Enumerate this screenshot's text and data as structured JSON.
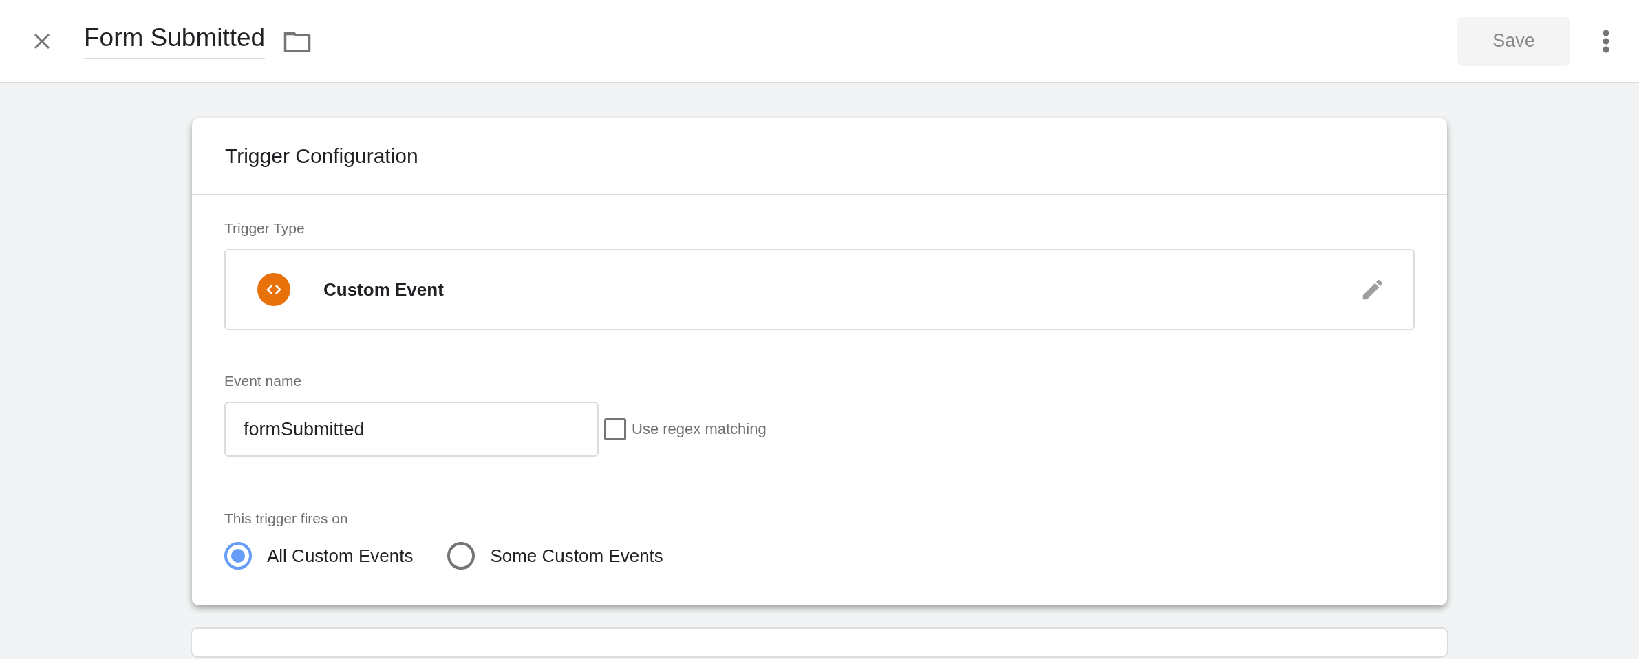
{
  "header": {
    "title": "Form Submitted",
    "save_button": {
      "label": "Save",
      "disabled": true
    }
  },
  "card": {
    "title": "Trigger Configuration",
    "trigger_type": {
      "label": "Trigger Type",
      "value": "Custom Event"
    },
    "event_name": {
      "label": "Event name",
      "value": "formSubmitted",
      "regex": {
        "label": "Use regex matching",
        "checked": false
      }
    },
    "fires_on": {
      "label": "This trigger fires on",
      "options": [
        {
          "label": "All Custom Events",
          "selected": true
        },
        {
          "label": "Some Custom Events",
          "selected": false
        }
      ]
    }
  }
}
